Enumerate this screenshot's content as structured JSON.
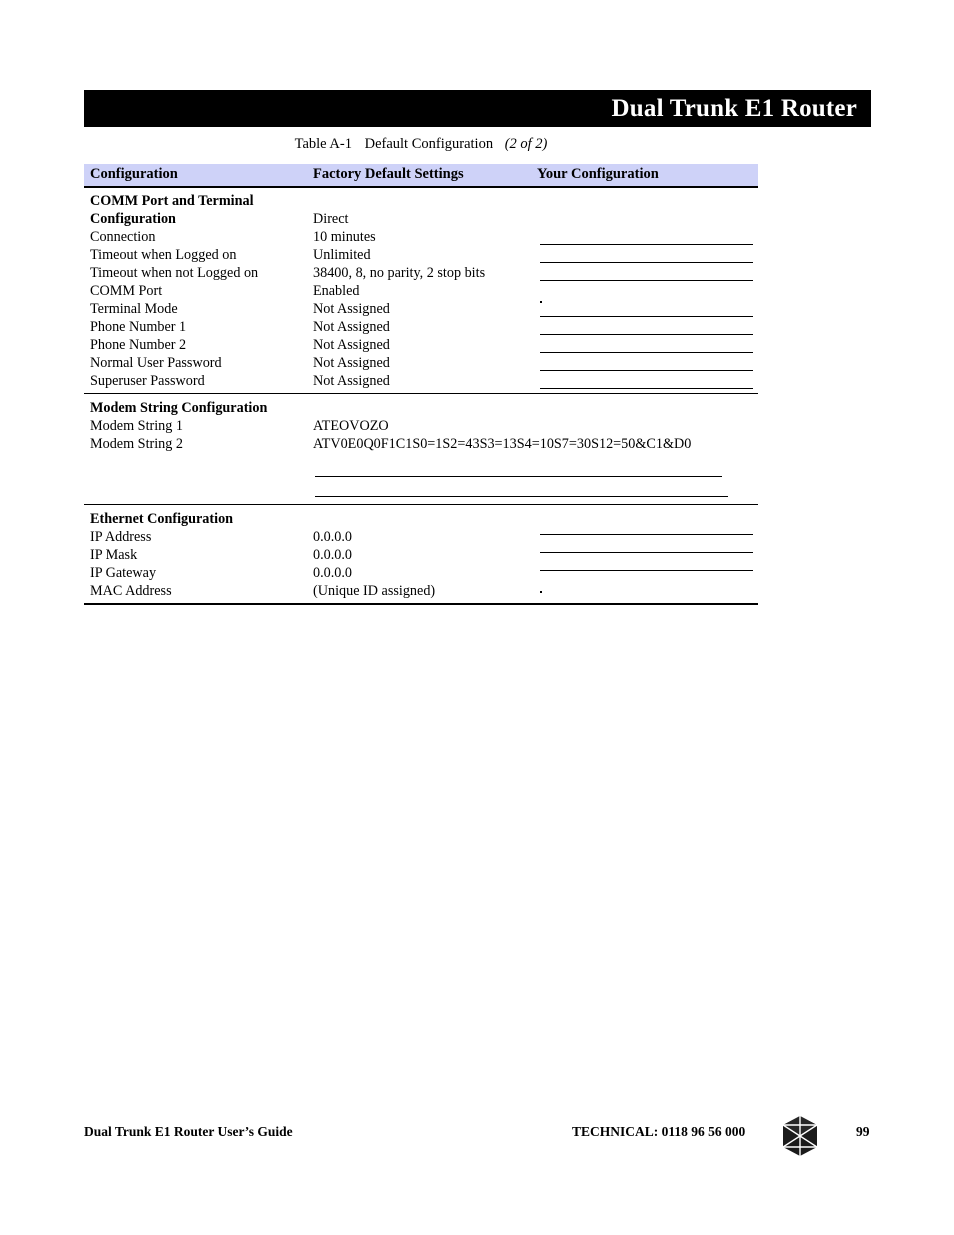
{
  "header": {
    "title": "Dual Trunk E1 Router"
  },
  "caption": {
    "number": "Table A-1",
    "title": "Default Configuration",
    "part": "(2 of 2)"
  },
  "table": {
    "columns": [
      "Configuration",
      "Factory Default Settings",
      "Your Configuration"
    ],
    "sections": [
      {
        "name": "comm-port-and-terminal",
        "rows": [
          {
            "label": "COMM Port and Terminal",
            "bold": true,
            "value": ""
          },
          {
            "label": "Configuration",
            "bold": true,
            "value": "Direct"
          },
          {
            "label": "Connection",
            "bold": false,
            "value": "10 minutes"
          },
          {
            "label": "Timeout when Logged on",
            "bold": false,
            "value": "Unlimited"
          },
          {
            "label": "Timeout when not Logged on",
            "bold": false,
            "value": "38400, 8, no parity, 2 stop bits"
          },
          {
            "label": "COMM Port",
            "bold": false,
            "value": "Enabled"
          },
          {
            "label": "Terminal Mode",
            "bold": false,
            "value": "Not Assigned"
          },
          {
            "label": "Phone Number 1",
            "bold": false,
            "value": "Not Assigned"
          },
          {
            "label": "Phone Number 2",
            "bold": false,
            "value": "Not Assigned"
          },
          {
            "label": "Normal User Password",
            "bold": false,
            "value": "Not Assigned"
          },
          {
            "label": "Superuser Password",
            "bold": false,
            "value": "Not Assigned"
          }
        ]
      },
      {
        "name": "modem-string-configuration",
        "rows": [
          {
            "label": "Modem String Configuration",
            "bold": true,
            "value": ""
          },
          {
            "label": "Modem String 1",
            "bold": false,
            "value": "ATEOVOZO"
          },
          {
            "label": "Modem String 2",
            "bold": false,
            "value": "ATV0E0Q0F1C1S0=1S2=43S3=13S4=10S7=30S12=50&C1&D0"
          }
        ]
      },
      {
        "name": "ethernet-configuration",
        "rows": [
          {
            "label": "Ethernet Configuration",
            "bold": true,
            "value": ""
          },
          {
            "label": "IP Address",
            "bold": false,
            "value": "0.0.0.0"
          },
          {
            "label": "IP Mask",
            "bold": false,
            "value": "0.0.0.0"
          },
          {
            "label": "IP Gateway",
            "bold": false,
            "value": "0.0.0.0"
          },
          {
            "label": "MAC Address",
            "bold": false,
            "value": "(Unique ID assigned)"
          }
        ]
      }
    ]
  },
  "footer": {
    "guide": "Dual Trunk E1 Router User’s Guide",
    "technical": "TECHNICAL:  0118 96 56 000",
    "logo": "black-box-diamond-logo",
    "page_number": "99"
  },
  "colors": {
    "header_bar": "#000000",
    "header_text": "#ffffff",
    "table_header_band": "#ced2f8",
    "rule": "#000000",
    "page_background": "#ffffff"
  }
}
